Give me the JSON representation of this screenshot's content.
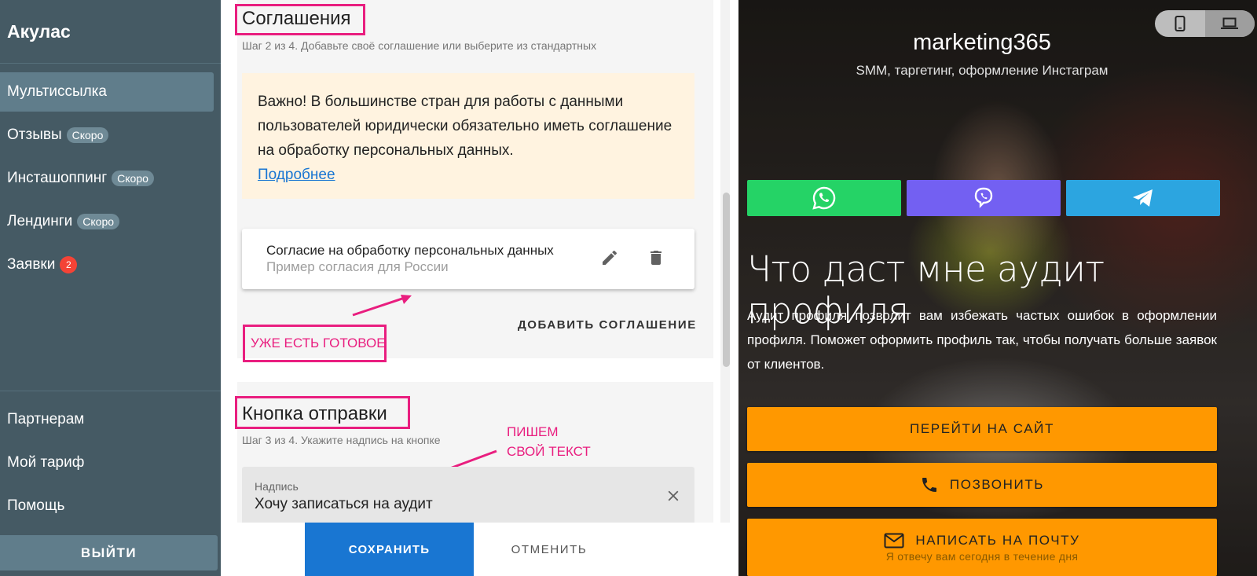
{
  "sidebar": {
    "title": "Акулас",
    "items": [
      {
        "label": "Мультиссылка",
        "active": true
      },
      {
        "label": "Отзывы",
        "badge": "Скоро"
      },
      {
        "label": "Инсташоппинг",
        "badge": "Скоро"
      },
      {
        "label": "Лендинги",
        "badge": "Скоро"
      },
      {
        "label": "Заявки",
        "count": "2"
      }
    ],
    "bottom_items": [
      {
        "label": "Партнерам"
      },
      {
        "label": "Мой тариф"
      },
      {
        "label": "Помощь"
      }
    ],
    "logout_label": "ВЫЙТИ"
  },
  "agreements": {
    "title": "Соглашения",
    "step": "Шаг 2 из 4. Добавьте своё соглашение или выберите из стандартных",
    "notice_text": "Важно! В большинстве стран для работы с данными пользователей юридически обязательно иметь соглашение на обработку персональных данных.",
    "notice_link": "Подробнее",
    "item_title": "Согласие на обработку персональных данных",
    "item_subtitle": "Пример согласия для России",
    "add_label": "ДОБАВИТЬ СОГЛАШЕНИЕ"
  },
  "annotations": {
    "ready": "УЖЕ ЕСТЬ ГОТОВОЕ",
    "write_line1": "ПИШЕМ",
    "write_line2": "СВОЙ ТЕКСТ",
    "color": "#e91e7f"
  },
  "submit": {
    "title": "Кнопка отправки",
    "step": "Шаг 3 из 4. Укажите надпись на кнопке",
    "field_label": "Надпись",
    "field_value": "Хочу записаться на аудит"
  },
  "footer": {
    "save_label": "СОХРАНИТЬ",
    "cancel_label": "ОТМЕНИТЬ"
  },
  "preview": {
    "name": "marketing365",
    "description": "SMM, таргетинг, оформление Инстаграм",
    "messengers": [
      {
        "name": "whatsapp-icon",
        "color": "#25d366"
      },
      {
        "name": "viber-icon",
        "color": "#7360f2"
      },
      {
        "name": "telegram-icon",
        "color": "#2ca5e0"
      }
    ],
    "heading": "Что даст мне аудит профиля",
    "text": "Аудит профиля позволит вам избежать частых ошибок в оформлении профиля. Поможет оформить профиль так, чтобы получать больше заявок от клиентов.",
    "buttons": [
      {
        "label": "ПЕРЕЙТИ НА САЙТ"
      },
      {
        "label": "ПОЗВОНИТЬ",
        "icon": "phone-icon"
      },
      {
        "label": "НАПИСАТЬ НА ПОЧТУ",
        "icon": "mail-icon",
        "sub": "Я отвечу вам сегодня в течение дня"
      }
    ],
    "accent": "#ff9800"
  }
}
